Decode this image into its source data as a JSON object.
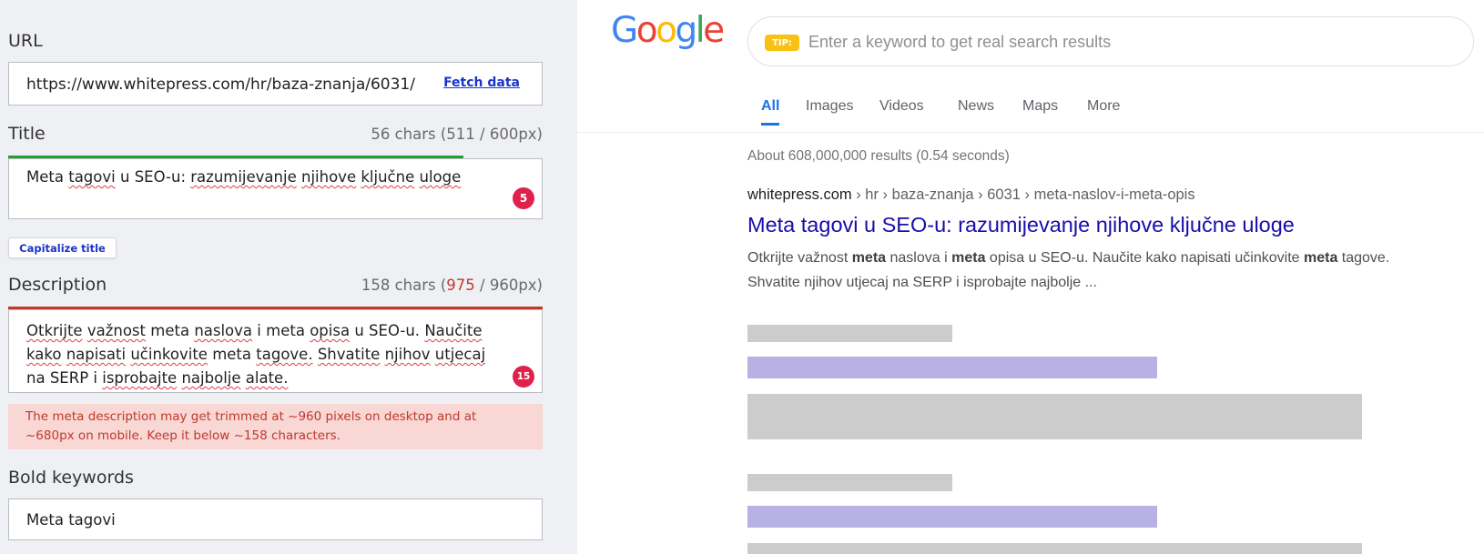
{
  "editor": {
    "url": {
      "label": "URL",
      "value": "https://www.whitepress.com/hr/baza-znanja/6031/",
      "fetch_label": "Fetch data"
    },
    "title": {
      "label": "Title",
      "count_prefix": "56 chars (511 / 600px)",
      "words": [
        {
          "text": "Meta",
          "misspelled": false
        },
        {
          "text": "tagovi",
          "misspelled": true
        },
        {
          "text": "u",
          "misspelled": false
        },
        {
          "text": "SEO-u:",
          "misspelled": false
        },
        {
          "text": "razumijevanje",
          "misspelled": true
        },
        {
          "text": "njihove",
          "misspelled": true
        },
        {
          "text": "ključne",
          "misspelled": true
        },
        {
          "text": "uloge",
          "misspelled": true
        }
      ],
      "error_count": "5",
      "length_fill": 0.852,
      "bar_color": "#22a02f",
      "capitalize_label": "Capitalize title"
    },
    "description": {
      "label": "Description",
      "count_prefix": "158 chars (",
      "count_over": "975",
      "count_suffix": " / 960px)",
      "words": [
        {
          "text": "Otkrijte",
          "misspelled": true
        },
        {
          "text": "važnost",
          "misspelled": true
        },
        {
          "text": "meta",
          "misspelled": false
        },
        {
          "text": "naslova",
          "misspelled": true
        },
        {
          "text": "i",
          "misspelled": false
        },
        {
          "text": "meta",
          "misspelled": false
        },
        {
          "text": "opisa",
          "misspelled": true
        },
        {
          "text": "u",
          "misspelled": false
        },
        {
          "text": "SEO-u.",
          "misspelled": false
        },
        {
          "text": "Naučite",
          "misspelled": true
        },
        {
          "text": "kako",
          "misspelled": true
        },
        {
          "text": "napisati",
          "misspelled": true
        },
        {
          "text": "učinkovite",
          "misspelled": true
        },
        {
          "text": "meta",
          "misspelled": false
        },
        {
          "text": "tagove.",
          "misspelled": true
        },
        {
          "text": "Shvatite",
          "misspelled": true
        },
        {
          "text": "njihov",
          "misspelled": true
        },
        {
          "text": "utjecaj",
          "misspelled": true
        },
        {
          "text": "na",
          "misspelled": false
        },
        {
          "text": "SERP",
          "misspelled": false
        },
        {
          "text": "i",
          "misspelled": false
        },
        {
          "text": "isprobajte",
          "misspelled": true
        },
        {
          "text": "najbolje",
          "misspelled": true
        },
        {
          "text": "alate.",
          "misspelled": true
        }
      ],
      "error_count": "15",
      "length_fill": 1.0,
      "bar_color": "#c0392b",
      "warning_line1": "The meta description may get trimmed at ~960 pixels on desktop and at",
      "warning_line2": "~680px on mobile. Keep it below ~158 characters."
    },
    "bold_keywords": {
      "label": "Bold keywords",
      "value": "Meta tagovi"
    }
  },
  "serp": {
    "logo": [
      {
        "char": "G",
        "color": "#4285f4"
      },
      {
        "char": "o",
        "color": "#ea4335"
      },
      {
        "char": "o",
        "color": "#fbbc05"
      },
      {
        "char": "g",
        "color": "#4285f4"
      },
      {
        "char": "l",
        "color": "#34a853"
      },
      {
        "char": "e",
        "color": "#ea4335"
      }
    ],
    "search": {
      "tip_label": "TIP:",
      "placeholder": "Enter a keyword to get real search results"
    },
    "tabs": [
      "All",
      "Images",
      "Videos",
      "News",
      "Maps",
      "More"
    ],
    "active_tab": "All",
    "stats": "About 608,000,000 results (0.54 seconds)",
    "result": {
      "domain": "whitepress.com",
      "path": [
        "hr",
        "baza-znanja",
        "6031",
        "meta-naslov-i-meta-opis"
      ],
      "title": "Meta tagovi u SEO-u: razumijevanje njihove ključne uloge",
      "snippet": [
        {
          "t": "Otkrijte važnost ",
          "b": false
        },
        {
          "t": "meta",
          "b": true
        },
        {
          "t": " naslova i ",
          "b": false
        },
        {
          "t": "meta",
          "b": true
        },
        {
          "t": " opisa u SEO-u. Naučite kako napisati učinkovite ",
          "b": false
        },
        {
          "t": "meta",
          "b": true
        },
        {
          "t": " tagove. Shvatite njihov utjecaj na SERP i isprobajte najbolje ...",
          "b": false
        }
      ]
    }
  },
  "colors": {
    "accent_link": "#1a34c8",
    "serp_title": "#1a0dab",
    "badge": "#e0214a",
    "warning_bg": "#f8d7d5",
    "warning_text": "#c0392b",
    "placeholder_gray": "#cccccc",
    "placeholder_purple": "#b7b2e3"
  }
}
